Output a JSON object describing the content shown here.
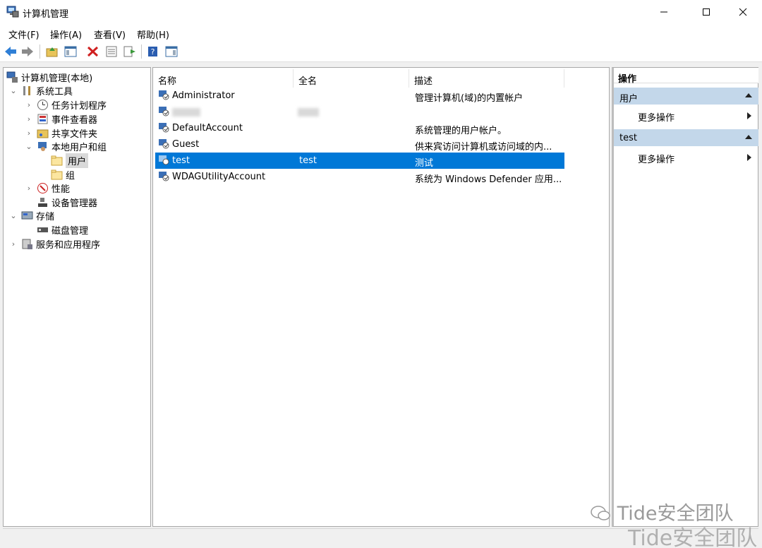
{
  "window": {
    "title": "计算机管理"
  },
  "menu": [
    "文件(F)",
    "操作(A)",
    "查看(V)",
    "帮助(H)"
  ],
  "tree": {
    "root": "计算机管理(本地)",
    "system_tools": "系统工具",
    "task_scheduler": "任务计划程序",
    "event_viewer": "事件查看器",
    "shared_folders": "共享文件夹",
    "local_users_groups": "本地用户和组",
    "users": "用户",
    "groups": "组",
    "performance": "性能",
    "device_manager": "设备管理器",
    "storage": "存储",
    "disk_management": "磁盘管理",
    "services_apps": "服务和应用程序"
  },
  "list": {
    "columns": [
      "名称",
      "全名",
      "描述"
    ],
    "rows": [
      {
        "name": "Administrator",
        "fullname": "",
        "description": "管理计算机(域)的内置帐户"
      },
      {
        "name": "",
        "fullname": "",
        "description": ""
      },
      {
        "name": "DefaultAccount",
        "fullname": "",
        "description": "系统管理的用户帐户。"
      },
      {
        "name": "Guest",
        "fullname": "",
        "description": "供来宾访问计算机或访问域的内..."
      },
      {
        "name": "test",
        "fullname": "test",
        "description": "测试"
      },
      {
        "name": "WDAGUtilityAccount",
        "fullname": "",
        "description": "系统为 Windows Defender 应用..."
      }
    ],
    "selected_row": "test"
  },
  "actions": {
    "header": "操作",
    "group1": "用户",
    "group1_item": "更多操作",
    "group2": "test",
    "group2_item": "更多操作"
  },
  "watermark": {
    "text": "Tide安全团队",
    "text2": "Tide安全团队"
  },
  "colors": {
    "selection": "#0078d7",
    "action_group": "#c3d7ea"
  }
}
